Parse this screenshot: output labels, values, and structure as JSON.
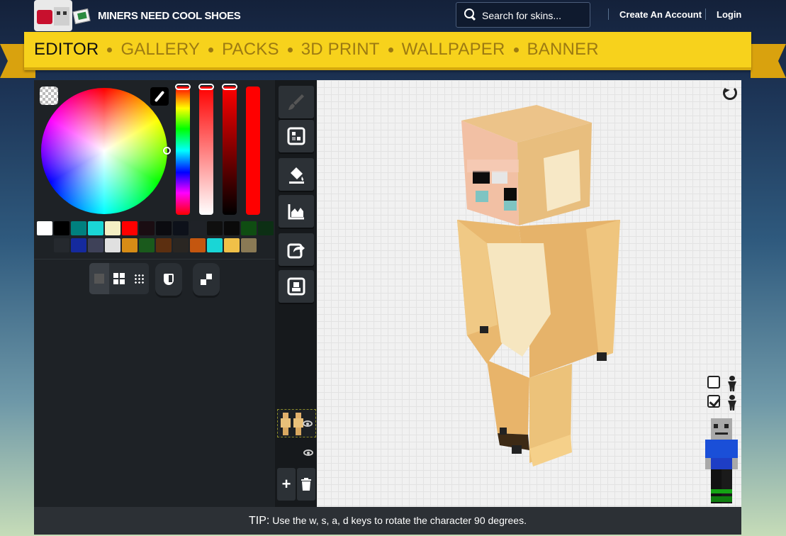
{
  "header": {
    "site_name": "MINERS NEED COOL SHOES",
    "search": {
      "placeholder": "Search for skins..."
    },
    "links": {
      "create_account": "Create An Account",
      "login": "Login"
    }
  },
  "nav": {
    "items": [
      {
        "label": "EDITOR",
        "active": true
      },
      {
        "label": "GALLERY",
        "active": false
      },
      {
        "label": "PACKS",
        "active": false
      },
      {
        "label": "3D PRINT",
        "active": false
      },
      {
        "label": "WALLPAPER",
        "active": false
      },
      {
        "label": "BANNER",
        "active": false
      }
    ]
  },
  "colors": {
    "selected": "#ff0000",
    "palette_row1": [
      "#ffffff",
      "#000000",
      "#00807f",
      "#1ad6d6",
      "#f4efc4",
      "#ff0000",
      "#1a0d12",
      "#0b0b10",
      "#0d111a",
      "#1f2227",
      "#0f0f0f",
      "#0a0a0a",
      "#0f4d12",
      "#0c2f14"
    ],
    "palette_row2": [
      "#25292e",
      "#152a9e",
      "#3e4158",
      "#e0e0e0",
      "#d78c16",
      "#1a5a1c",
      "#5c2f10",
      "#2a2622",
      "#c4560f",
      "#19d6d6",
      "#f0c048",
      "#8a7a55"
    ]
  },
  "tools": [
    "brush-icon",
    "noise-icon",
    "bucket-icon",
    "shade-icon",
    "export-icon",
    "skin-icon"
  ],
  "viewport": {
    "show_overlay_checked": false,
    "show_base_checked": true
  },
  "tip": {
    "label": "TIP:",
    "text": "Use the w, s, a, d keys to rotate the character 90 degrees."
  }
}
